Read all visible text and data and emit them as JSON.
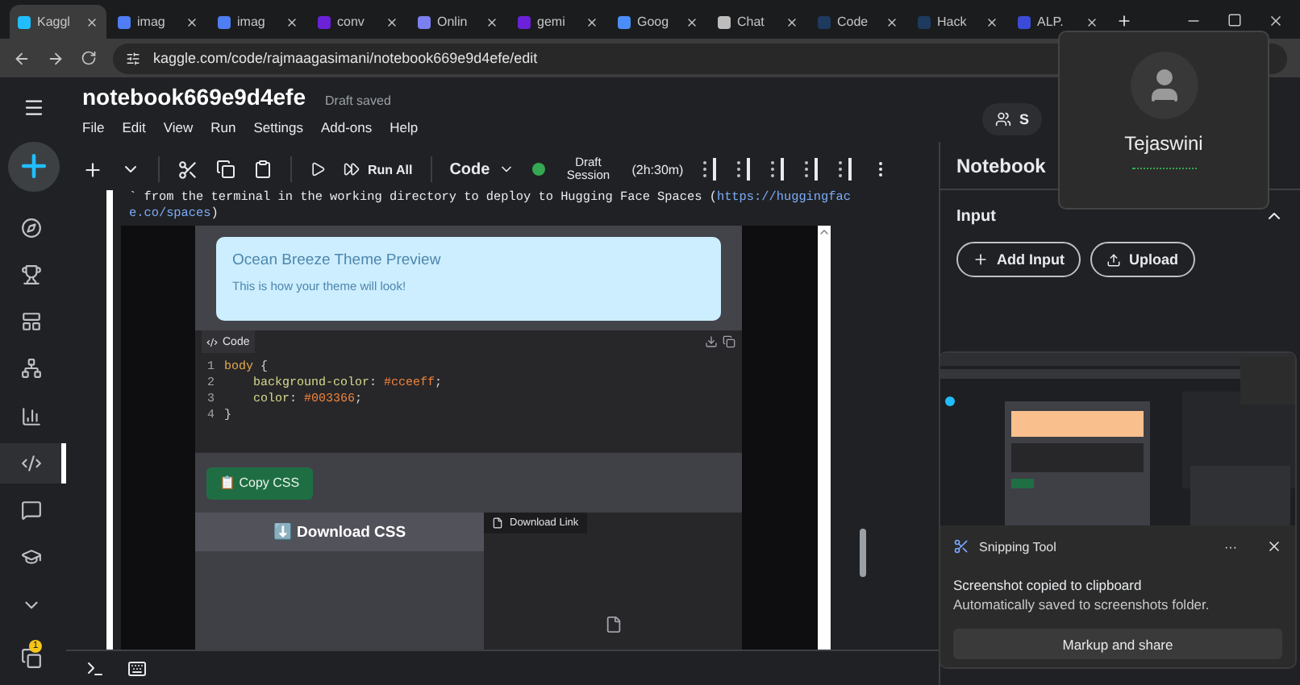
{
  "browser_tabs": [
    {
      "label": "Kaggl",
      "selected": true,
      "color": "#20beff"
    },
    {
      "label": "imag",
      "selected": false,
      "color": "#4f7df3"
    },
    {
      "label": "imag",
      "selected": false,
      "color": "#4f7df3"
    },
    {
      "label": "conv",
      "selected": false,
      "color": "#6b21d8"
    },
    {
      "label": "Onlin",
      "selected": false,
      "color": "#7b7ff0"
    },
    {
      "label": "gemi",
      "selected": false,
      "color": "#6b21d8"
    },
    {
      "label": "Goog",
      "selected": false,
      "color": "#4b8df8"
    },
    {
      "label": "Chat",
      "selected": false,
      "color": "#bdbdbd"
    },
    {
      "label": "Code",
      "selected": false,
      "color": "#1e3a5f"
    },
    {
      "label": "Hack",
      "selected": false,
      "color": "#1e3a5f"
    },
    {
      "label": "ALP.",
      "selected": false,
      "color": "#3b4bd8"
    }
  ],
  "address": "kaggle.com/code/rajmaagasimani/notebook669e9d4efe/edit",
  "notebook": {
    "title": "notebook669e9d4efe",
    "status": "Draft saved",
    "share": "S"
  },
  "menu": [
    "File",
    "Edit",
    "View",
    "Run",
    "Settings",
    "Add-ons",
    "Help"
  ],
  "toolbar": {
    "run_all": "Run All",
    "cell_type": "Code",
    "session_on": true,
    "session": "Draft Session",
    "time": "(2h:30m)"
  },
  "output_lines": [
    {
      "text": "` from the terminal in the working directory to deploy to Hugging Face Spaces (",
      "link": "https://huggingfac"
    },
    {
      "link": "e.co/spaces",
      "text": ")"
    }
  ],
  "preview": {
    "title": "Ocean Breeze Theme Preview",
    "subtitle": "This is how your theme will look!"
  },
  "code_block": {
    "label": "Code",
    "lines": [
      {
        "number": "1",
        "tokens": [
          {
            "text": "body",
            "kind": "selector"
          },
          {
            "text": " {",
            "kind": "punct"
          }
        ]
      },
      {
        "number": "2",
        "tokens": [
          {
            "text": "    background-color",
            "kind": "property"
          },
          {
            "text": ": ",
            "kind": "punct"
          },
          {
            "text": "#cceeff",
            "kind": "value"
          },
          {
            "text": ";",
            "kind": "punct"
          }
        ]
      },
      {
        "number": "3",
        "tokens": [
          {
            "text": "    color",
            "kind": "property"
          },
          {
            "text": ": ",
            "kind": "punct"
          },
          {
            "text": "#003366",
            "kind": "value"
          },
          {
            "text": ";",
            "kind": "punct"
          }
        ]
      },
      {
        "number": "4",
        "tokens": [
          {
            "text": "}",
            "kind": "punct"
          }
        ]
      }
    ]
  },
  "copy_button": "📋 Copy CSS",
  "download_button": "⬇️ Download CSS",
  "download_link_label": "Download Link",
  "right_panel": {
    "title": "Notebook",
    "section": "Input",
    "buttons": [
      "Add Input",
      "Upload"
    ]
  },
  "profile": {
    "name": "Tejaswini"
  },
  "toast": {
    "app": "Snipping Tool",
    "more": "···",
    "title": "Screenshot copied to clipboard",
    "body": "Automatically saved to screenshots folder.",
    "action": "Markup and share"
  },
  "notification_count": "1",
  "sidebar_items": [
    {
      "selected": false
    },
    {
      "selected": false
    },
    {
      "selected": false
    },
    {
      "selected": false
    },
    {
      "selected": false
    },
    {
      "selected": true
    },
    {
      "selected": false
    },
    {
      "selected": false
    },
    {
      "selected": false
    }
  ]
}
